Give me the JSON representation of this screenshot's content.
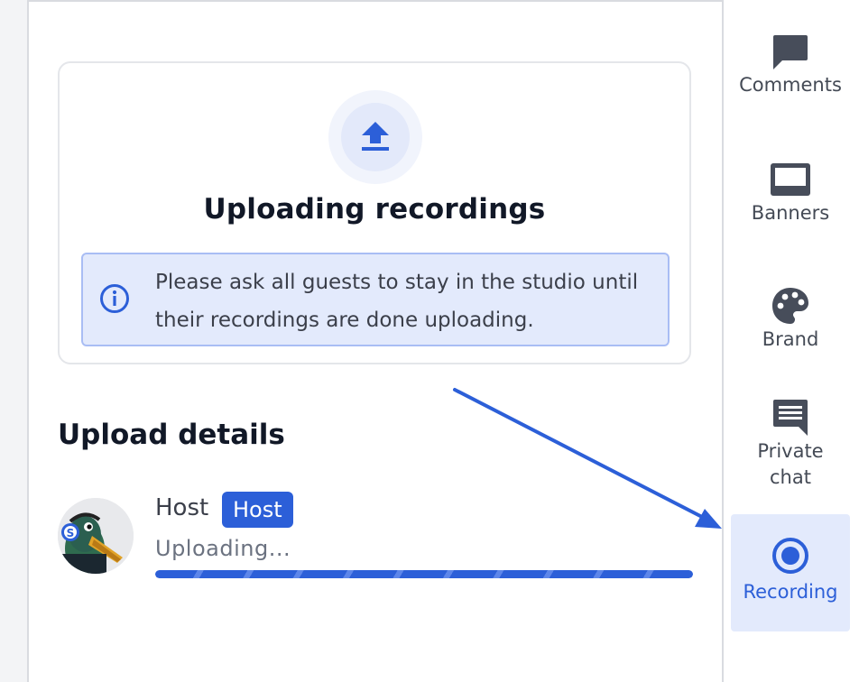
{
  "upload_card": {
    "title": "Uploading recordings",
    "info_message": "Please ask all guests to stay in the studio until their recordings are done uploading."
  },
  "upload_details": {
    "heading": "Upload details",
    "participants": [
      {
        "name": "Host",
        "role_badge": "Host",
        "status": "Uploading...",
        "progress": 1.0
      }
    ]
  },
  "sidebar": {
    "items": [
      {
        "label": "Comments",
        "icon": "comment-icon",
        "active": false
      },
      {
        "label": "Banners",
        "icon": "banner-icon",
        "active": false
      },
      {
        "label": "Brand",
        "icon": "palette-icon",
        "active": false
      },
      {
        "label": "Private chat",
        "icon": "private-chat-icon",
        "active": false
      },
      {
        "label": "Recording",
        "icon": "record-icon",
        "active": true
      }
    ]
  },
  "colors": {
    "accent": "#2c5fd8",
    "info_bg": "#e3eafc",
    "info_border": "#a9bdf4",
    "text_primary": "#111827",
    "text_secondary": "#3b3f4a",
    "active_nav_bg": "#e3eafc"
  }
}
